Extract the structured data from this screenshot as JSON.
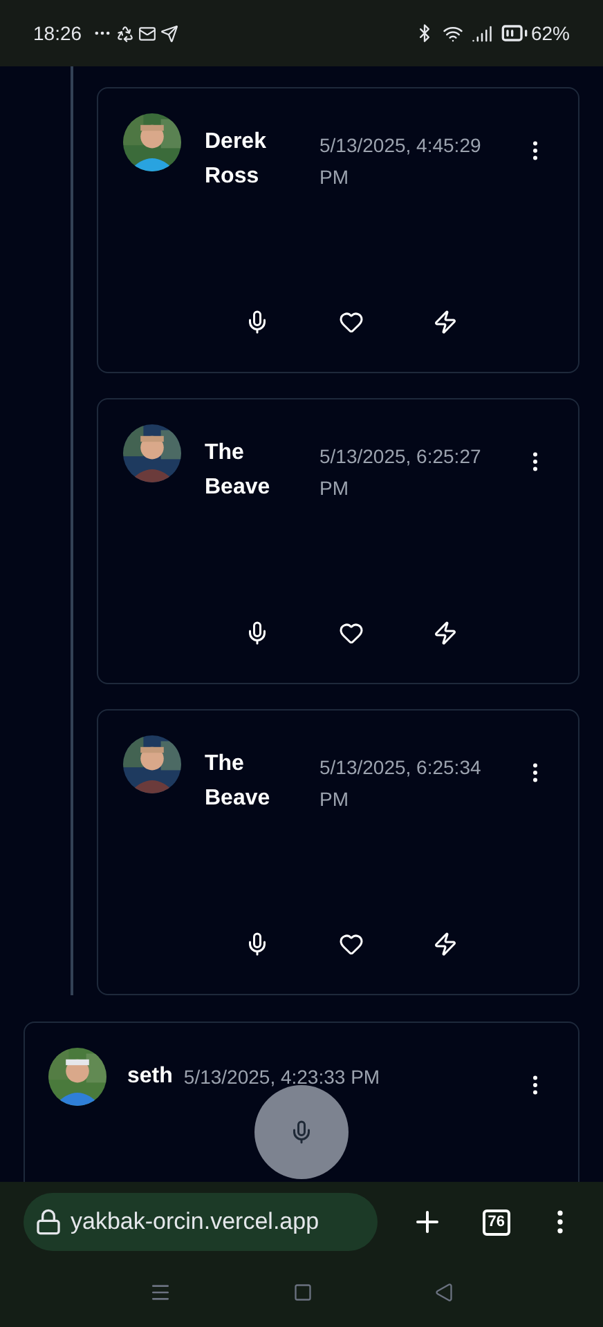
{
  "status_bar": {
    "time": "18:26",
    "battery": "62%"
  },
  "thread_replies": [
    {
      "name": "Derek\nRoss",
      "timestamp": "5/13/2025, 4:45:29 PM"
    },
    {
      "name": "The\nBeave",
      "timestamp": "5/13/2025, 6:25:27 PM"
    },
    {
      "name": "The\nBeave",
      "timestamp": "5/13/2025, 6:25:34 PM"
    }
  ],
  "post": {
    "name": "seth",
    "timestamp": "5/13/2025, 4:23:33 PM"
  },
  "browser_bar": {
    "url": "yakbak-orcin.vercel.app",
    "tab_count": "76"
  }
}
